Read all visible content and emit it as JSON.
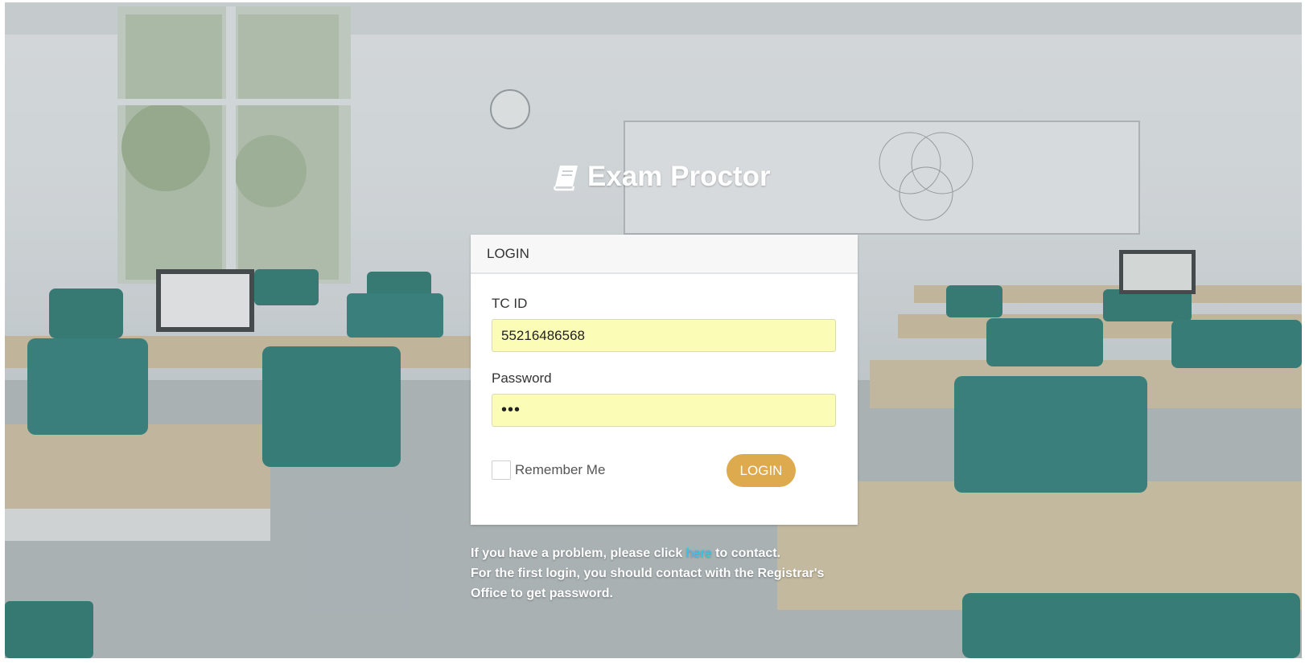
{
  "app": {
    "title": "Exam Proctor",
    "icon": "book-icon"
  },
  "login_panel": {
    "header": "LOGIN",
    "tcid_label": "TC ID",
    "tcid_value": "55216486568",
    "password_label": "Password",
    "password_value": "•••",
    "remember_label": "Remember Me",
    "remember_checked": false,
    "button_label": "LOGIN"
  },
  "help": {
    "line1_before": "If you have a problem, please click ",
    "link_text": "here",
    "line1_after": " to contact.",
    "line2": "For the first login, you should contact with the Registrar's Office to get password."
  },
  "colors": {
    "accent_button": "#ddaa4e",
    "link": "#3bc4ec",
    "autofill_field": "#fbfdb7"
  }
}
